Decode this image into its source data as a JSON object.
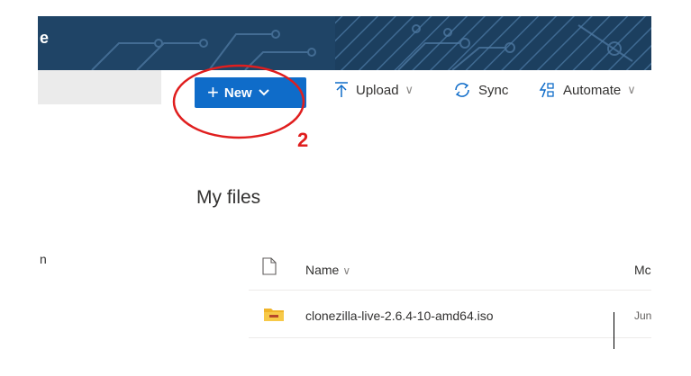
{
  "header": {
    "app_letter": "e"
  },
  "toolbar": {
    "new_label": "New",
    "upload_label": "Upload",
    "sync_label": "Sync",
    "automate_label": "Automate"
  },
  "main": {
    "title": "My files",
    "columns": {
      "name": "Name",
      "modified": "Mc"
    },
    "rows": [
      {
        "name": "clonezilla-live-2.6.4-10-amd64.iso",
        "modified": "Jun",
        "icon": "folder-zip-icon"
      }
    ]
  },
  "sidebar": {
    "partial_item": "n"
  },
  "annotation": {
    "step_number": "2",
    "color": "#e01e1e"
  },
  "colors": {
    "accent": "#0f6cc9",
    "header": "#1c3f5f",
    "selected_nav": "#ebebeb"
  }
}
